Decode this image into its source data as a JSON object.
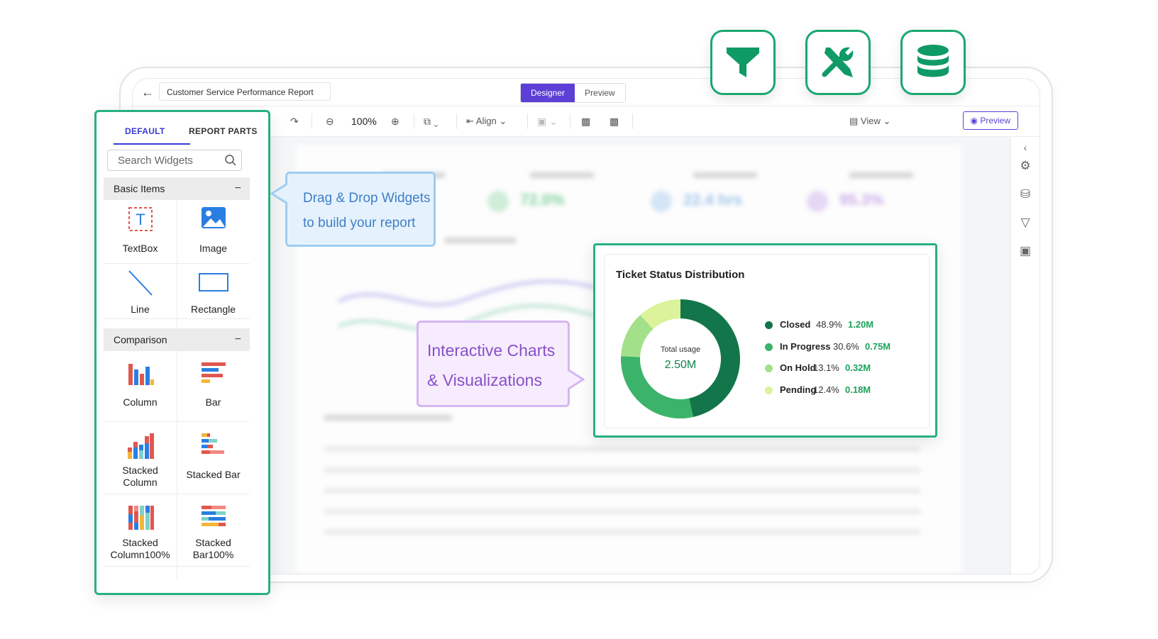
{
  "report": {
    "title": "Customer Service Performance Report",
    "modes": [
      "Designer",
      "Preview"
    ]
  },
  "toolbar": {
    "zoom": "100%",
    "align_label": "Align",
    "view_label": "View",
    "preview_button": "Preview"
  },
  "panel": {
    "tabs": [
      "DEFAULT",
      "REPORT PARTS"
    ],
    "search_placeholder": "Search Widgets",
    "groups": [
      {
        "label": "Basic Items",
        "collapse": "−"
      },
      {
        "label": "Comparison",
        "collapse": "−"
      }
    ],
    "items": {
      "textbox": "TextBox",
      "image": "Image",
      "line": "Line",
      "rectangle": "Rectangle",
      "column": "Column",
      "bar": "Bar",
      "stacked_column": [
        "Stacked",
        "Column"
      ],
      "stacked_bar": "Stacked Bar",
      "stacked_column100": [
        "Stacked",
        "Column100%"
      ],
      "stacked_bar100": [
        "Stacked",
        "Bar100%"
      ]
    }
  },
  "callouts": {
    "drag_drop": [
      "Drag & Drop Widgets",
      "to build your report"
    ],
    "charts": [
      "Interactive Charts",
      "& Visualizations"
    ]
  },
  "background_kpis": [
    "72.0%",
    "22.4 hrs",
    "95.3%"
  ],
  "chart_data": {
    "type": "pie",
    "title": "Ticket Status Distribution",
    "center_label": "Total usage",
    "center_value": "2.50M",
    "series": [
      {
        "name": "Closed",
        "percent": 48.9,
        "percent_label": "48.9%",
        "value_label": "1.20M",
        "color": "#13754a"
      },
      {
        "name": "In Progress",
        "percent": 30.6,
        "percent_label": "30.6%",
        "value_label": "0.75M",
        "color": "#3cb36a"
      },
      {
        "name": "On Hold",
        "percent": 13.1,
        "percent_label": "13.1%",
        "value_label": "0.32M",
        "color": "#a3e08a"
      },
      {
        "name": "Pending",
        "percent": 12.4,
        "percent_label": "12.4%",
        "value_label": "0.18M",
        "color": "#dcf29b"
      }
    ]
  },
  "colors": {
    "accent_green": "#27b082",
    "designer_purple": "#5b3fd6"
  },
  "icons": [
    "filter-icon",
    "tools-icon",
    "database-icon"
  ]
}
